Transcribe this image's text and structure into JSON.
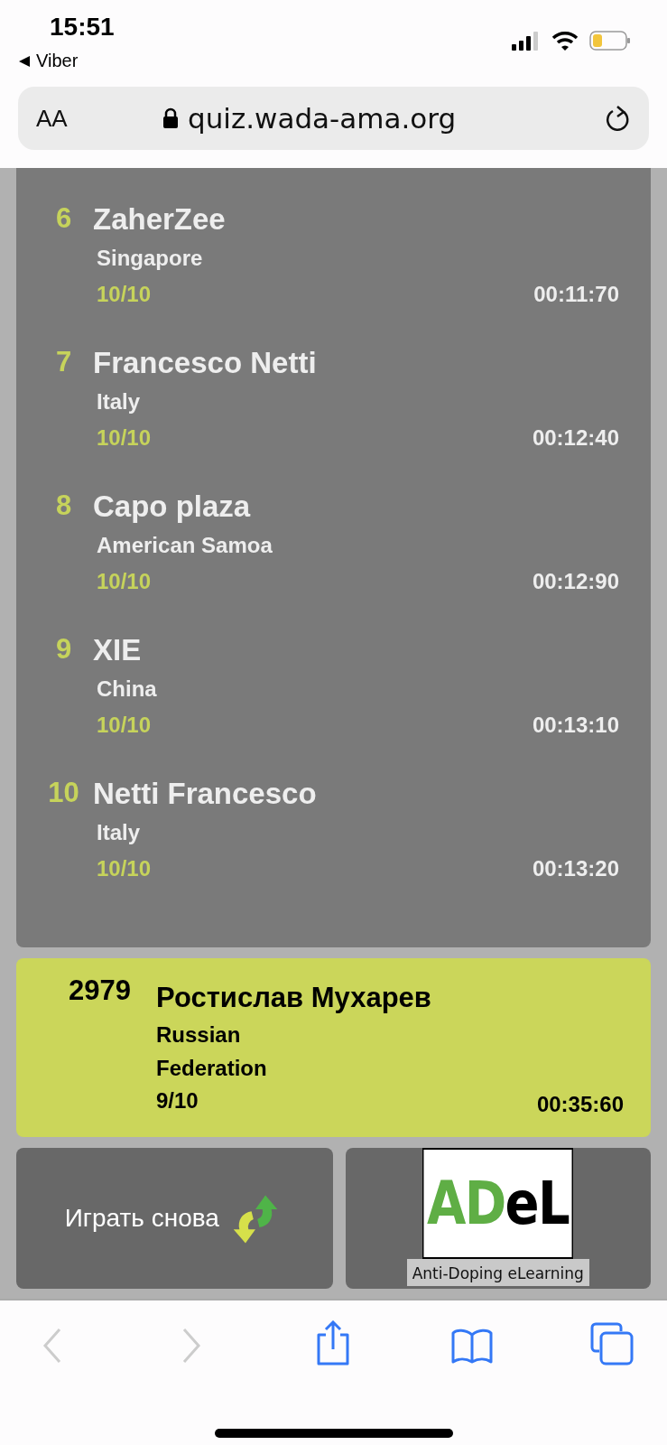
{
  "status_bar": {
    "time": "15:51",
    "back_app": "Viber"
  },
  "address_bar": {
    "text_size": "AA",
    "url": "quiz.wada-ama.org"
  },
  "leaderboard": [
    {
      "rank": "6",
      "name": "ZaherZee",
      "country": "Singapore",
      "score": "10/10",
      "time": "00:11:70"
    },
    {
      "rank": "7",
      "name": "Francesco Netti",
      "country": "Italy",
      "score": "10/10",
      "time": "00:12:40"
    },
    {
      "rank": "8",
      "name": "Capo plaza",
      "country": "American Samoa",
      "score": "10/10",
      "time": "00:12:90"
    },
    {
      "rank": "9",
      "name": "XIE",
      "country": "China",
      "score": "10/10",
      "time": "00:13:10"
    },
    {
      "rank": "10",
      "name": "Netti Francesco",
      "country": "Italy",
      "score": "10/10",
      "time": "00:13:20"
    }
  ],
  "my_result": {
    "rank": "2979",
    "name": "Ростислав Мухарев",
    "country": "Russian Federation",
    "score": "9/10",
    "time": "00:35:60"
  },
  "play_again_button": "Играть снова",
  "adel_logo": {
    "green_part": "AD",
    "black_part": "eL",
    "caption": "Anti-Doping eLearning"
  }
}
